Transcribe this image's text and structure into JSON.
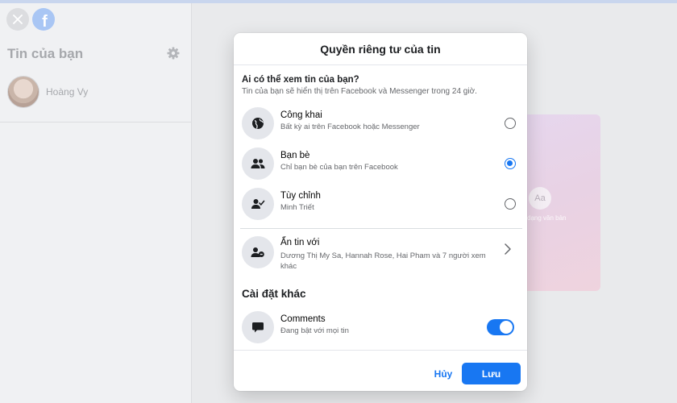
{
  "sidebar": {
    "title": "Tin của bạn",
    "user_name": "Hoàng Vy",
    "logo_letter": "f",
    "icons": {
      "close": "close-icon",
      "logo": "facebook-logo",
      "settings": "gear-icon"
    }
  },
  "preview": {
    "aa_label": "Aa",
    "text_label": "i dạng văn bản"
  },
  "modal": {
    "title": "Quyền riêng tư của tin",
    "question": "Ai có thể xem tin của bạn?",
    "question_sub": "Tin của bạn sẽ hiển thị trên Facebook và Messenger trong 24 giờ.",
    "options": [
      {
        "title": "Công khai",
        "subtitle": "Bất kỳ ai trên Facebook hoặc Messenger",
        "icon": "globe-icon",
        "selected": false
      },
      {
        "title": "Bạn bè",
        "subtitle": "Chỉ bạn bè của bạn trên Facebook",
        "icon": "friends-icon",
        "selected": true
      },
      {
        "title": "Tùy chỉnh",
        "subtitle": "Minh Triết",
        "icon": "custom-user-icon",
        "selected": false
      }
    ],
    "hide": {
      "title": "Ẩn tin với",
      "subtitle": "Dương Thị My Sa, Hannah Rose, Hai Pham và 7 người xem khác",
      "icon": "hide-users-icon"
    },
    "other_settings_title": "Cài đặt khác",
    "comments": {
      "title": "Comments",
      "subtitle": "Đang bật với mọi tin",
      "icon": "comment-icon",
      "enabled": true
    },
    "cancel_label": "Hủy",
    "save_label": "Lưu"
  },
  "colors": {
    "accent": "#1877f2",
    "background": "#e9eaec",
    "modal": "#ffffff",
    "secondary_text": "#65676b"
  }
}
